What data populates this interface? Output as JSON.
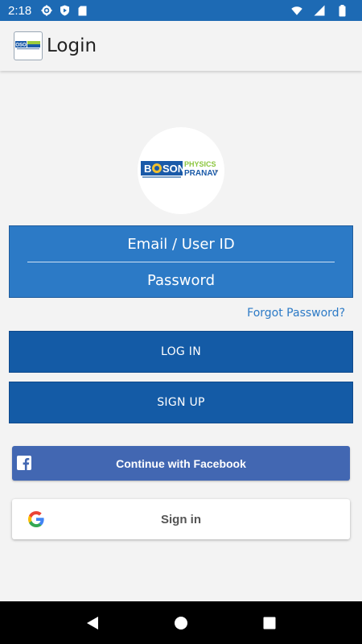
{
  "status_bar": {
    "time": "2:18",
    "icons": [
      "settings-icon",
      "shield-play-icon",
      "sd-card-icon",
      "wifi-icon",
      "signal-icon",
      "battery-icon"
    ]
  },
  "app_bar": {
    "title": "Login",
    "logo_icon": "boson-physics-logo"
  },
  "logo": {
    "line1": "B",
    "boson_tail": "SON",
    "physics": "PHYSICS",
    "by": "by",
    "pranav": "PRANAV"
  },
  "form": {
    "email_placeholder": "Email / User ID",
    "password_placeholder": "Password",
    "forgot_password": "Forgot Password?"
  },
  "buttons": {
    "login": "LOG IN",
    "signup": "SIGN UP",
    "facebook": "Continue with Facebook",
    "google": "Sign in"
  },
  "nav_bar": {
    "icons": [
      "back-icon",
      "home-icon",
      "recents-icon"
    ]
  },
  "colors": {
    "status_bar": "#1d6ab4",
    "panel_blue": "#2c7ac6",
    "button_blue": "#145ba6",
    "facebook_blue": "#4267b2",
    "background": "#f3f3f3"
  }
}
